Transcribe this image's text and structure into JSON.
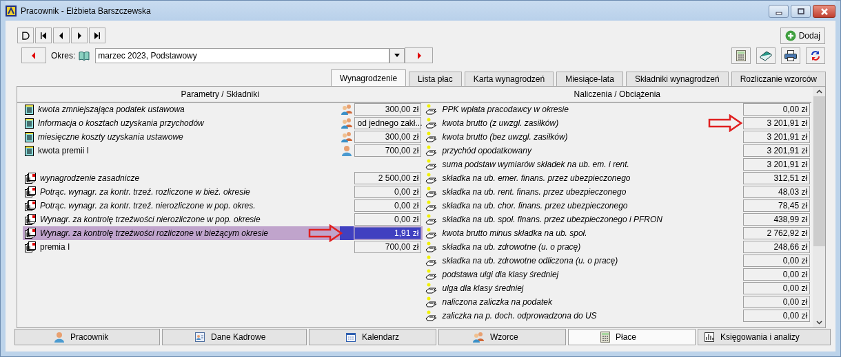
{
  "window": {
    "title": "Pracownik - Elżbieta Barszczewska"
  },
  "add_button": {
    "label": "Dodaj"
  },
  "period": {
    "label": "Okres:",
    "value": "marzec 2023, Podstawowy"
  },
  "tabs": [
    {
      "label": "Wynagrodzenie",
      "selected": true
    },
    {
      "label": "Lista płac",
      "selected": false
    },
    {
      "label": "Karta wynagrodzeń",
      "selected": false
    },
    {
      "label": "Miesiące-lata",
      "selected": false
    },
    {
      "label": "Składniki wynagrodzeń",
      "selected": false
    },
    {
      "label": "Rozliczanie wzorców",
      "selected": false
    }
  ],
  "left_header": "Parametry / Składniki",
  "right_header": "Naliczenia / Obciążenia",
  "parameters": [
    {
      "label": "kwota zmniejszająca podatek ustawowa",
      "italic": true,
      "kind": "group",
      "value": "300,00 zł"
    },
    {
      "label": "Informacja o kosztach uzyskania przychodów",
      "italic": true,
      "kind": "group",
      "value": "od jednego zakł..."
    },
    {
      "label": "miesięczne koszty uzyskania ustawowe",
      "italic": true,
      "kind": "group",
      "value": "300,00 zł"
    },
    {
      "label": "kwota premii I",
      "italic": false,
      "kind": "person",
      "value": "700,00 zł"
    }
  ],
  "components": [
    {
      "label": "wynagrodzenie zasadnicze",
      "italic": true,
      "value": "2 500,00 zł",
      "selected": false,
      "marked": false
    },
    {
      "label": "Potrąc. wynagr. za kontr. trzeź. rozliczone w bież. okresie",
      "italic": true,
      "value": "0,00 zł",
      "selected": false,
      "marked": false
    },
    {
      "label": "Potrąc. wynagr. za kontr. trzeź. nierozliczone w pop. okres.",
      "italic": true,
      "value": "0,00 zł",
      "selected": false,
      "marked": false
    },
    {
      "label": "Wynagr. za kontrolę trzeźwości nierozliczone w pop. okresie",
      "italic": true,
      "value": "0,00 zł",
      "selected": false,
      "marked": false
    },
    {
      "label": "Wynagr. za kontrolę trzeźwości rozliczone w bieżącym okresie",
      "italic": true,
      "value": "1,91 zł",
      "selected": true,
      "marked": true
    },
    {
      "label": "premia I",
      "italic": false,
      "value": "700,00 zł",
      "selected": false,
      "marked": false
    }
  ],
  "charges": [
    {
      "label": "PPK wpłata pracodawcy w okresie",
      "value": "0,00 zł",
      "marked": false
    },
    {
      "label": "kwota brutto (z uwzgl. zasiłków)",
      "value": "3 201,91 zł",
      "marked": true
    },
    {
      "label": "kwota brutto (bez uwzgl. zasiłków)",
      "value": "3 201,91 zł",
      "marked": false
    },
    {
      "label": "przychód opodatkowany",
      "value": "3 201,91 zł",
      "marked": false
    },
    {
      "label": "suma podstaw wymiarów składek na ub. em. i rent.",
      "value": "3 201,91 zł",
      "marked": false
    },
    {
      "label": "składka na ub. emer. finans. przez ubezpieczonego",
      "value": "312,51 zł",
      "marked": false
    },
    {
      "label": "składka na ub. rent. finans. przez ubezpieczonego",
      "value": "48,03 zł",
      "marked": false
    },
    {
      "label": "składka na ub. chor. finans. przez ubezpieczonego",
      "value": "78,45 zł",
      "marked": false
    },
    {
      "label": "składka na ub. społ. finans. przez ubezpieczonego i PFRON",
      "value": "438,99 zł",
      "marked": false
    },
    {
      "label": "kwota brutto minus składka na ub. społ.",
      "value": "2 762,92 zł",
      "marked": false
    },
    {
      "label": "składka na ub. zdrowotne (u. o pracę)",
      "value": "248,66 zł",
      "marked": false
    },
    {
      "label": "składka na ub. zdrowotne odliczona (u. o pracę)",
      "value": "0,00 zł",
      "marked": false
    },
    {
      "label": "podstawa ulgi dla klasy średniej",
      "value": "0,00 zł",
      "marked": false
    },
    {
      "label": "ulga dla klasy średniej",
      "value": "0,00 zł",
      "marked": false
    },
    {
      "label": "naliczona zaliczka na podatek",
      "value": "0,00 zł",
      "marked": false
    },
    {
      "label": "zaliczka na p. doch. odprowadzona do US",
      "value": "0,00 zł",
      "marked": false
    }
  ],
  "bottom_tabs": [
    {
      "label": "Pracownik",
      "kind": "person",
      "selected": false
    },
    {
      "label": "Dane Kadrowe",
      "kind": "card",
      "selected": false
    },
    {
      "label": "Kalendarz",
      "kind": "calendar",
      "selected": false
    },
    {
      "label": "Wzorce",
      "kind": "group",
      "selected": false
    },
    {
      "label": "Płace",
      "kind": "calculator",
      "selected": true
    },
    {
      "label": "Księgowania i analizy",
      "kind": "chart",
      "selected": false
    }
  ]
}
